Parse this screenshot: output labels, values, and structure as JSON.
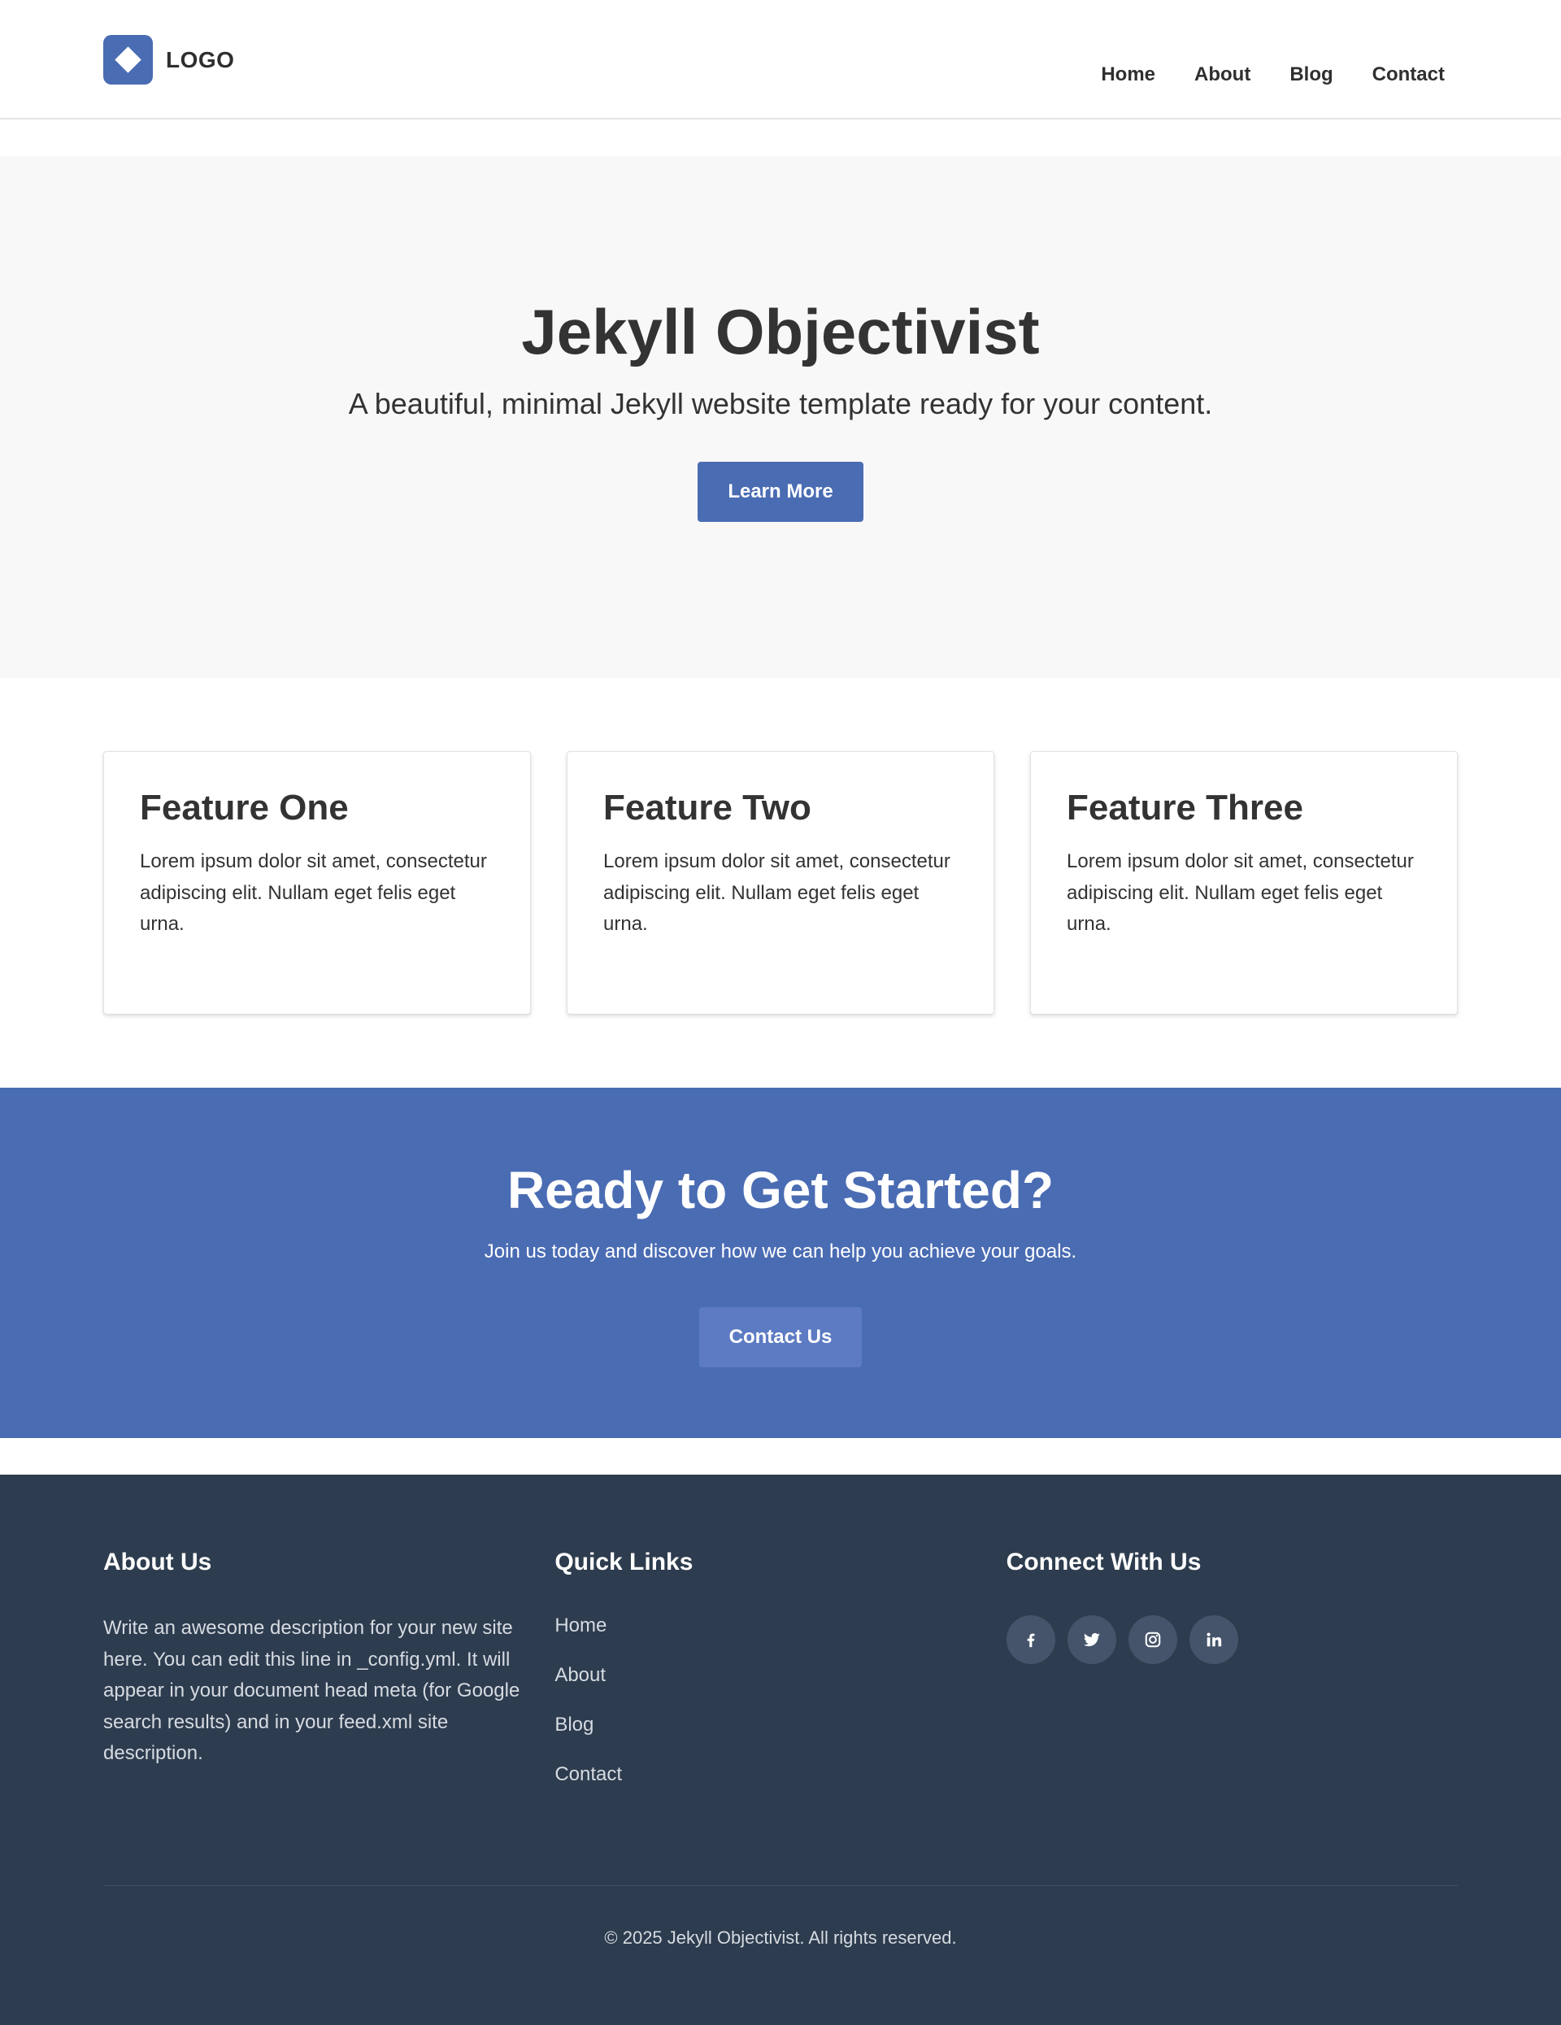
{
  "header": {
    "logo_text": "LOGO",
    "nav": [
      {
        "label": "Home"
      },
      {
        "label": "About"
      },
      {
        "label": "Blog"
      },
      {
        "label": "Contact"
      }
    ]
  },
  "hero": {
    "title": "Jekyll Objectivist",
    "subtitle": "A beautiful, minimal Jekyll website template ready for your content.",
    "button_label": "Learn More"
  },
  "features": [
    {
      "title": "Feature One",
      "text": "Lorem ipsum dolor sit amet, consectetur adipiscing elit. Nullam eget felis eget urna."
    },
    {
      "title": "Feature Two",
      "text": "Lorem ipsum dolor sit amet, consectetur adipiscing elit. Nullam eget felis eget urna."
    },
    {
      "title": "Feature Three",
      "text": "Lorem ipsum dolor sit amet, consectetur adipiscing elit. Nullam eget felis eget urna."
    }
  ],
  "cta": {
    "title": "Ready to Get Started?",
    "text": "Join us today and discover how we can help you achieve your goals.",
    "button_label": "Contact Us"
  },
  "footer": {
    "about": {
      "heading": "About Us",
      "text": "Write an awesome description for your new site here. You can edit this line in _config.yml. It will appear in your document head meta (for Google search results) and in your feed.xml site description."
    },
    "quick_links": {
      "heading": "Quick Links",
      "links": [
        {
          "label": "Home"
        },
        {
          "label": "About"
        },
        {
          "label": "Blog"
        },
        {
          "label": "Contact"
        }
      ]
    },
    "connect": {
      "heading": "Connect With Us",
      "icons": [
        "facebook-icon",
        "twitter-icon",
        "instagram-icon",
        "linkedin-icon"
      ]
    },
    "copyright": "© 2025 Jekyll Objectivist. All rights reserved."
  },
  "colors": {
    "primary": "#4a6cb3",
    "cta_button": "#5d7bc3",
    "footer_bg": "#2d3c4e",
    "hero_bg": "#f8f8f8",
    "text": "#333333"
  }
}
